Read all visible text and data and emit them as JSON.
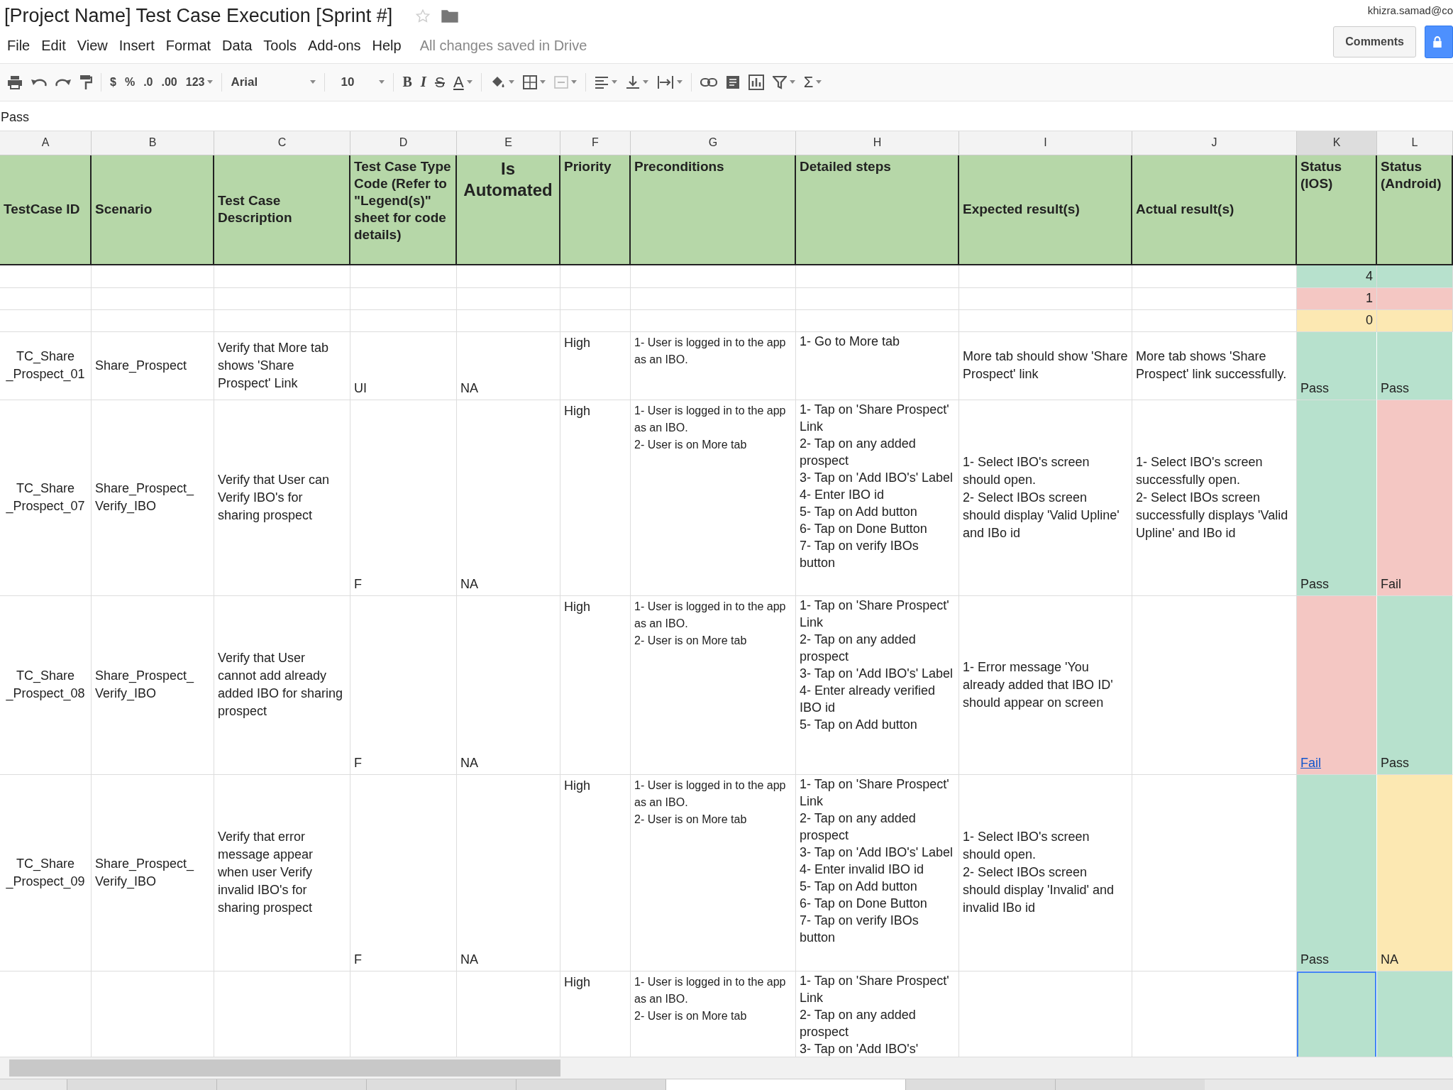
{
  "document": {
    "title": "[Project Name] Test Case Execution [Sprint #]"
  },
  "account": "khizra.samad@co",
  "menu": [
    "File",
    "Edit",
    "View",
    "Insert",
    "Format",
    "Data",
    "Tools",
    "Add-ons",
    "Help"
  ],
  "save_status": "All changes saved in Drive",
  "comments_button": "Comments",
  "toolbar": {
    "currency": "$",
    "percent": "%",
    "decrease_decimals": ".0",
    "increase_decimals": ".00",
    "number_format": "123",
    "font": "Arial",
    "font_size": "10",
    "bold": "B",
    "italic": "I",
    "strikethrough": "S",
    "text_color": "A",
    "functions": "Σ"
  },
  "formula_bar": {
    "value": "Pass"
  },
  "columns": [
    {
      "label": "A",
      "selected": false
    },
    {
      "label": "B",
      "selected": false
    },
    {
      "label": "C",
      "selected": false
    },
    {
      "label": "D",
      "selected": false
    },
    {
      "label": "E",
      "selected": false
    },
    {
      "label": "F",
      "selected": false
    },
    {
      "label": "G",
      "selected": false
    },
    {
      "label": "H",
      "selected": false
    },
    {
      "label": "I",
      "selected": false
    },
    {
      "label": "J",
      "selected": false
    },
    {
      "label": "K",
      "selected": true
    },
    {
      "label": "L",
      "selected": false
    }
  ],
  "header": [
    "TestCase ID",
    "Scenario",
    "Test Case Description",
    "Test Case Type Code (Refer to \"Legend(s)\" sheet for code details)",
    "Is Automated",
    "Priority",
    "Preconditions",
    "Detailed steps",
    "Expected result(s)",
    "Actual result(s)",
    "Status (IOS)",
    "Status (Android)"
  ],
  "summary_rows": [
    {
      "count": "4",
      "color": "#b7e1cd"
    },
    {
      "count": "1",
      "color": "#f4c7c3"
    },
    {
      "count": "0",
      "color": "#fce8b2"
    }
  ],
  "rows": [
    {
      "id": "TC_Share\n_Prospect_01",
      "scenario": "Share_Prospect",
      "description": "Verify that More tab shows 'Share Prospect' Link",
      "type_code": "UI",
      "automated": "NA",
      "priority": "High",
      "preconditions": "1- User is logged in to the app as an IBO.",
      "steps": "1- Go to More tab",
      "expected": "More tab should show 'Share Prospect' link",
      "actual": "More tab shows 'Share Prospect' link successfully.",
      "status_ios": {
        "text": "Pass",
        "color": "#b7e1cd",
        "selected": false
      },
      "status_android": {
        "text": "Pass",
        "color": "#b7e1cd",
        "selected": false
      }
    },
    {
      "id": "TC_Share\n_Prospect_07",
      "scenario": "Share_Prospect_\nVerify_IBO",
      "description": "Verify that User can Verify IBO's for sharing prospect",
      "type_code": "F",
      "automated": "NA",
      "priority": "High",
      "preconditions": "1- User is logged in to the app as an IBO.\n2- User is on More tab",
      "steps": "1- Tap on 'Share Prospect' Link\n2- Tap on any added prospect\n3- Tap on 'Add IBO's' Label\n4- Enter IBO id\n5- Tap on Add button\n6- Tap on Done Button\n7- Tap on verify IBOs button",
      "expected": "1- Select IBO's screen should open.\n2- Select IBOs screen should display 'Valid Upline' and IBo id",
      "actual": "1- Select IBO's screen successfully open.\n2- Select IBOs screen successfully displays 'Valid Upline' and IBo id",
      "status_ios": {
        "text": "Pass",
        "color": "#b7e1cd",
        "selected": false
      },
      "status_android": {
        "text": "Fail",
        "color": "#f4c7c3",
        "selected": false
      }
    },
    {
      "id": "TC_Share\n_Prospect_08",
      "scenario": "Share_Prospect_\nVerify_IBO",
      "description": "Verify that User cannot add already added IBO for sharing prospect",
      "type_code": "F",
      "automated": "NA",
      "priority": "High",
      "preconditions": "1- User is logged in to the app as an IBO.\n2- User is on More tab",
      "steps": "1- Tap on 'Share Prospect' Link\n2- Tap on any added prospect\n3- Tap on 'Add IBO's' Label\n4- Enter already verified IBO id\n5- Tap on Add button",
      "expected": "1- Error message 'You already added that IBO ID' should appear on screen",
      "status_ios": {
        "text": "Fail",
        "color": "#f4c7c3",
        "link": true,
        "selected": false
      },
      "status_android": {
        "text": "Pass",
        "color": "#b7e1cd",
        "selected": false
      }
    },
    {
      "id": "TC_Share\n_Prospect_09",
      "scenario": "Share_Prospect_\nVerify_IBO",
      "description": "Verify that error message appear when user Verify invalid IBO's for sharing prospect",
      "type_code": "F",
      "automated": "NA",
      "priority": "High",
      "preconditions": "1- User is logged in to the app as an IBO.\n2- User is on More tab",
      "steps": "1- Tap on 'Share Prospect' Link\n2- Tap on any added prospect\n3- Tap on 'Add IBO's' Label\n4- Enter invalid IBO id\n5- Tap on Add button\n6- Tap on Done Button\n7- Tap on verify IBOs button",
      "expected": "1- Select IBO's screen should open.\n2- Select IBOs screen should display 'Invalid' and invalid IBo id",
      "status_ios": {
        "text": "Pass",
        "color": "#b7e1cd",
        "selected": false
      },
      "status_android": {
        "text": "NA",
        "color": "#fce8b2",
        "selected": false
      }
    },
    {
      "priority": "High",
      "preconditions": "1- User is logged in to the app as an IBO.\n2- User is on More tab",
      "steps": "1- Tap on 'Share Prospect' Link\n2- Tap on any added prospect\n3- Tap on 'Add IBO's'",
      "status_ios": {
        "color": "#b7e1cd",
        "selected": true
      },
      "status_android": {
        "color": "#b7e1cd",
        "selected": false
      }
    }
  ],
  "sheet_tabs": [
    {
      "selected": false
    },
    {
      "selected": false
    },
    {
      "selected": false
    },
    {
      "selected": false
    },
    {
      "selected": true
    },
    {
      "selected": false
    },
    {
      "selected": false
    }
  ]
}
